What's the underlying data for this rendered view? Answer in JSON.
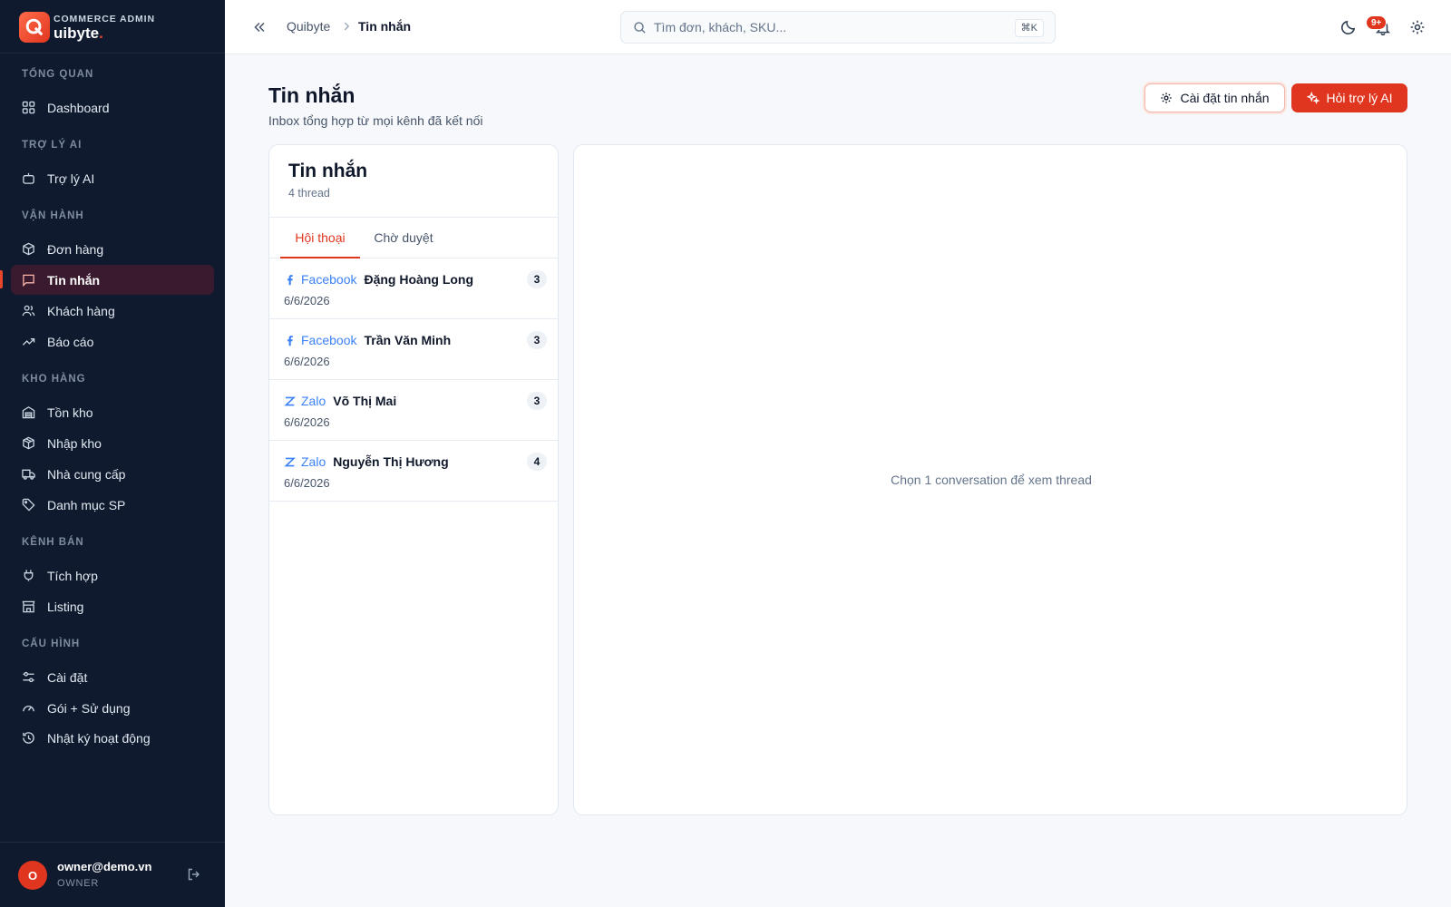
{
  "brand": {
    "sub": "COMMERCE ADMIN",
    "name": "uibyte",
    "dot": "."
  },
  "sidebar": {
    "sections": [
      {
        "label": "TỔNG QUAN",
        "items": [
          {
            "label": "Dashboard",
            "icon": "dashboard-icon"
          }
        ]
      },
      {
        "label": "TRỢ LÝ AI",
        "items": [
          {
            "label": "Trợ lý AI",
            "icon": "robot-icon"
          }
        ]
      },
      {
        "label": "VẬN HÀNH",
        "items": [
          {
            "label": "Đơn hàng",
            "icon": "box-icon"
          },
          {
            "label": "Tin nhắn",
            "icon": "message-icon",
            "active": true
          },
          {
            "label": "Khách hàng",
            "icon": "users-icon"
          },
          {
            "label": "Báo cáo",
            "icon": "trending-icon"
          }
        ]
      },
      {
        "label": "KHO HÀNG",
        "items": [
          {
            "label": "Tồn kho",
            "icon": "warehouse-icon"
          },
          {
            "label": "Nhập kho",
            "icon": "package-in-icon"
          },
          {
            "label": "Nhà cung cấp",
            "icon": "truck-icon"
          },
          {
            "label": "Danh mục SP",
            "icon": "tag-icon"
          }
        ]
      },
      {
        "label": "KÊNH BÁN",
        "items": [
          {
            "label": "Tích hợp",
            "icon": "plug-icon"
          },
          {
            "label": "Listing",
            "icon": "store-icon"
          }
        ]
      },
      {
        "label": "CẤU HÌNH",
        "items": [
          {
            "label": "Cài đặt",
            "icon": "sliders-icon"
          },
          {
            "label": "Gói + Sử dụng",
            "icon": "gauge-icon"
          },
          {
            "label": "Nhật ký hoạt động",
            "icon": "history-icon"
          }
        ]
      }
    ]
  },
  "user": {
    "initial": "O",
    "email": "owner@demo.vn",
    "role": "OWNER"
  },
  "topbar": {
    "breadcrumb_root": "Quibyte",
    "breadcrumb_current": "Tin nhắn",
    "search_placeholder": "Tìm đơn, khách, SKU...",
    "search_shortcut": "⌘K",
    "notification_count": "9+"
  },
  "page": {
    "title": "Tin nhắn",
    "subtitle": "Inbox tổng hợp từ mọi kênh đã kết nối",
    "settings_button": "Cài đặt tin nhắn",
    "ai_button": "Hỏi trợ lý AI"
  },
  "inbox": {
    "title": "Tin nhắn",
    "count": "4 thread",
    "tabs": [
      "Hội thoại",
      "Chờ duyệt"
    ],
    "threads": [
      {
        "channel": "Facebook",
        "customer": "Đặng Hoàng Long",
        "date": "6/6/2026",
        "count": "3"
      },
      {
        "channel": "Facebook",
        "customer": "Trần Văn Minh",
        "date": "6/6/2026",
        "count": "3"
      },
      {
        "channel": "Zalo",
        "customer": "Võ Thị Mai",
        "date": "6/6/2026",
        "count": "3"
      },
      {
        "channel": "Zalo",
        "customer": "Nguyễn Thị Hương",
        "date": "6/6/2026",
        "count": "4"
      }
    ]
  },
  "detail": {
    "empty_message": "Chọn 1 conversation để xem thread"
  },
  "colors": {
    "accent": "#e0361f",
    "sidebar_bg": "#0f1a2e",
    "channel_link": "#3b82f6"
  }
}
